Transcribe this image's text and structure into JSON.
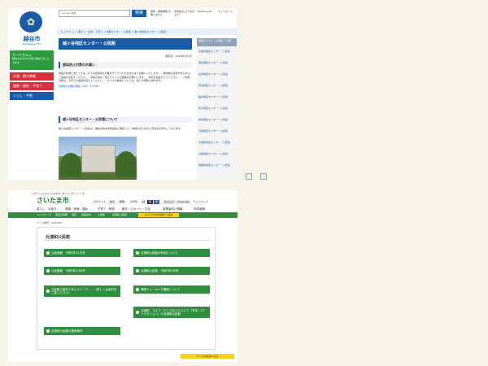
{
  "shot1": {
    "logo": {
      "city_name": "越谷市",
      "city_name_en": "Koshigaya City",
      "mark": "✿"
    },
    "mascot": {
      "label": "ガーヤちゃん",
      "text": "越谷がのびやか日記 越谷たのしんでます"
    },
    "nav": [
      "交通・観光情報",
      "健康・福祉・子育て",
      "くらし・手続"
    ],
    "search": {
      "placeholder": "Google 提供",
      "button": "検索"
    },
    "top_links": [
      "閲覧・補助機能 お問い合わせ",
      "音声読み上げ 読み上げ",
      "Multilingual",
      "サイトマップ"
    ],
    "breadcrumb": "トップページ > 暮らし・出産・子育て > 地区センター・公民館 > 越ヶ谷地区センター・公民館",
    "page_title": "越ヶ谷地区センター・公民館",
    "updated": "更新日：2023年4月1日",
    "section1": {
      "heading": "感染防止対策のお願い",
      "body": "施設の利用にあたっては、以下の感染防止対策を行っていただきますようお願いいたします。・発熱等の症状のある方はご来館をお控えください。・手指の消毒、咳エチケットの徹底をお願いします。・換気を適宜行ってください。・ご利用の際は、大声での会話を控えてください。・マスクの着用については、個人の判断に委ねます。",
      "link": "感染防止対策の徹底（PDF：170KB）"
    },
    "section2": {
      "heading": "越ヶ谷地区センター・公民館について",
      "body": "越ヶ谷地区センター・公民館は、越谷市中央市民会館に隣接した、地域の皆さまのご利用をお待ちしております。"
    },
    "right_sidebar": {
      "heading": "地区センター・公民館（一覧）",
      "links": [
        "北越谷地区センター・公民館",
        "蒲生地区センター・公民館",
        "出羽地区センター・公民館",
        "荻島地区センター・公民館",
        "桜井地区センター・公民館",
        "新方地区センター・公民館",
        "増林地区センター・公民館",
        "大袋地区センター・公民館",
        "大相模地区センター・公民館",
        "川柳地区センター・公民館",
        "南越谷地区センター・公民館"
      ]
    }
  },
  "shot2": {
    "tagline": "このサイトはさいたま市の公式ウェブサイトです。",
    "logo": "さいたま市",
    "tools": [
      "文字サイズ",
      "拡大",
      "標準",
      "背景色",
      "白",
      "黒",
      "青",
      "読み上げ",
      "Language",
      "サイトマップ"
    ],
    "menu": [
      "暮らし・手続き",
      "健康・医療・福祉",
      "子育て・教育",
      "観光・スポーツ・文化",
      "事業者向け情報",
      "市政情報"
    ],
    "greenbar": [
      "トップページ",
      "各区の情報",
      "北区",
      "施設案内",
      "公民館",
      "北浦和公民館"
    ],
    "yellow_label": "さいたま市の地図から探す",
    "breadcrumb": "ページ番号：0000000",
    "panel_title": "北浦和公民館",
    "buttons": [
      "公民館報　令和5年11月号",
      "北浦和公民館の利用について",
      "公民館報　令和5年10月号",
      "北浦和公民館　令和5年9月号",
      "公民館で始めてみようシニア……（詳しくは添付をご覧ください）",
      "健康ウォーキング講座について",
      "北浦和　ゴルフ・テニスなどについて（予定）（アトラクション）の北浦和公民館",
      "北浦和公民館の施設案内"
    ],
    "return_label": "ページの先頭へ戻る"
  },
  "broken_images": [
    "broken-image",
    "broken-image"
  ]
}
